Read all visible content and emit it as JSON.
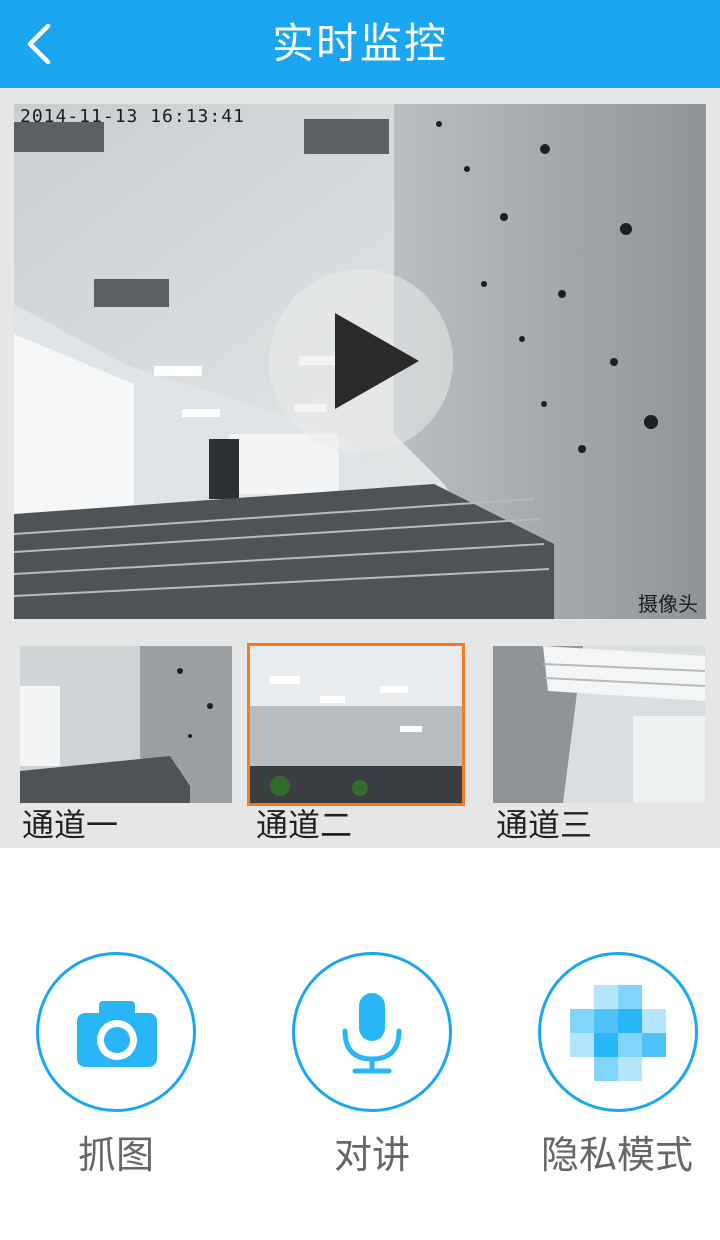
{
  "header": {
    "title": "实时监控",
    "back_icon": "chevron-left-icon"
  },
  "main_video": {
    "timestamp": "2014-11-13 16:13:41",
    "camera_name": "摄像头",
    "play_icon": "play-icon"
  },
  "channels": [
    {
      "label": "通道一",
      "selected": false
    },
    {
      "label": "通道二",
      "selected": true
    },
    {
      "label": "通道三",
      "selected": false
    }
  ],
  "actions": [
    {
      "label": "抓图",
      "icon": "camera-icon"
    },
    {
      "label": "对讲",
      "icon": "microphone-icon"
    },
    {
      "label": "隐私模式",
      "icon": "mosaic-icon"
    }
  ],
  "colors": {
    "accent": "#1aa6f0",
    "selected_border": "#f47b20",
    "icon_blue": "#29b6f6"
  }
}
